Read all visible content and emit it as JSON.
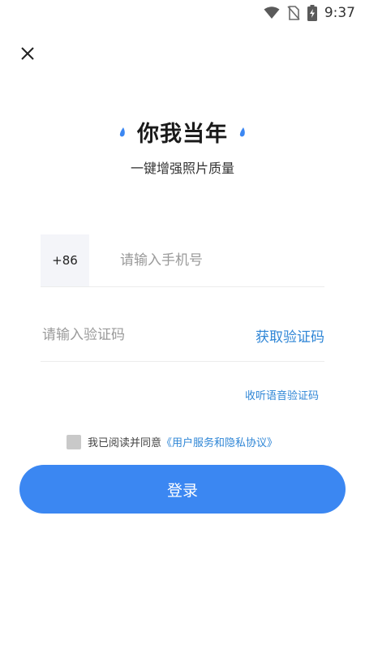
{
  "status_bar": {
    "time": "9:37"
  },
  "brand": {
    "title": "你我当年",
    "subtitle": "一键增强照片质量"
  },
  "login_form": {
    "country_code": "+86",
    "phone_placeholder": "请输入手机号",
    "code_placeholder": "请输入验证码",
    "get_code_label": "获取验证码",
    "voice_code_label": "收听语音验证码",
    "agreement_prefix": "我已阅读并同意",
    "agreement_link": "《用户服务和隐私协议》",
    "login_label": "登录"
  },
  "colors": {
    "accent": "#3b87f2",
    "link": "#2f86d6"
  }
}
